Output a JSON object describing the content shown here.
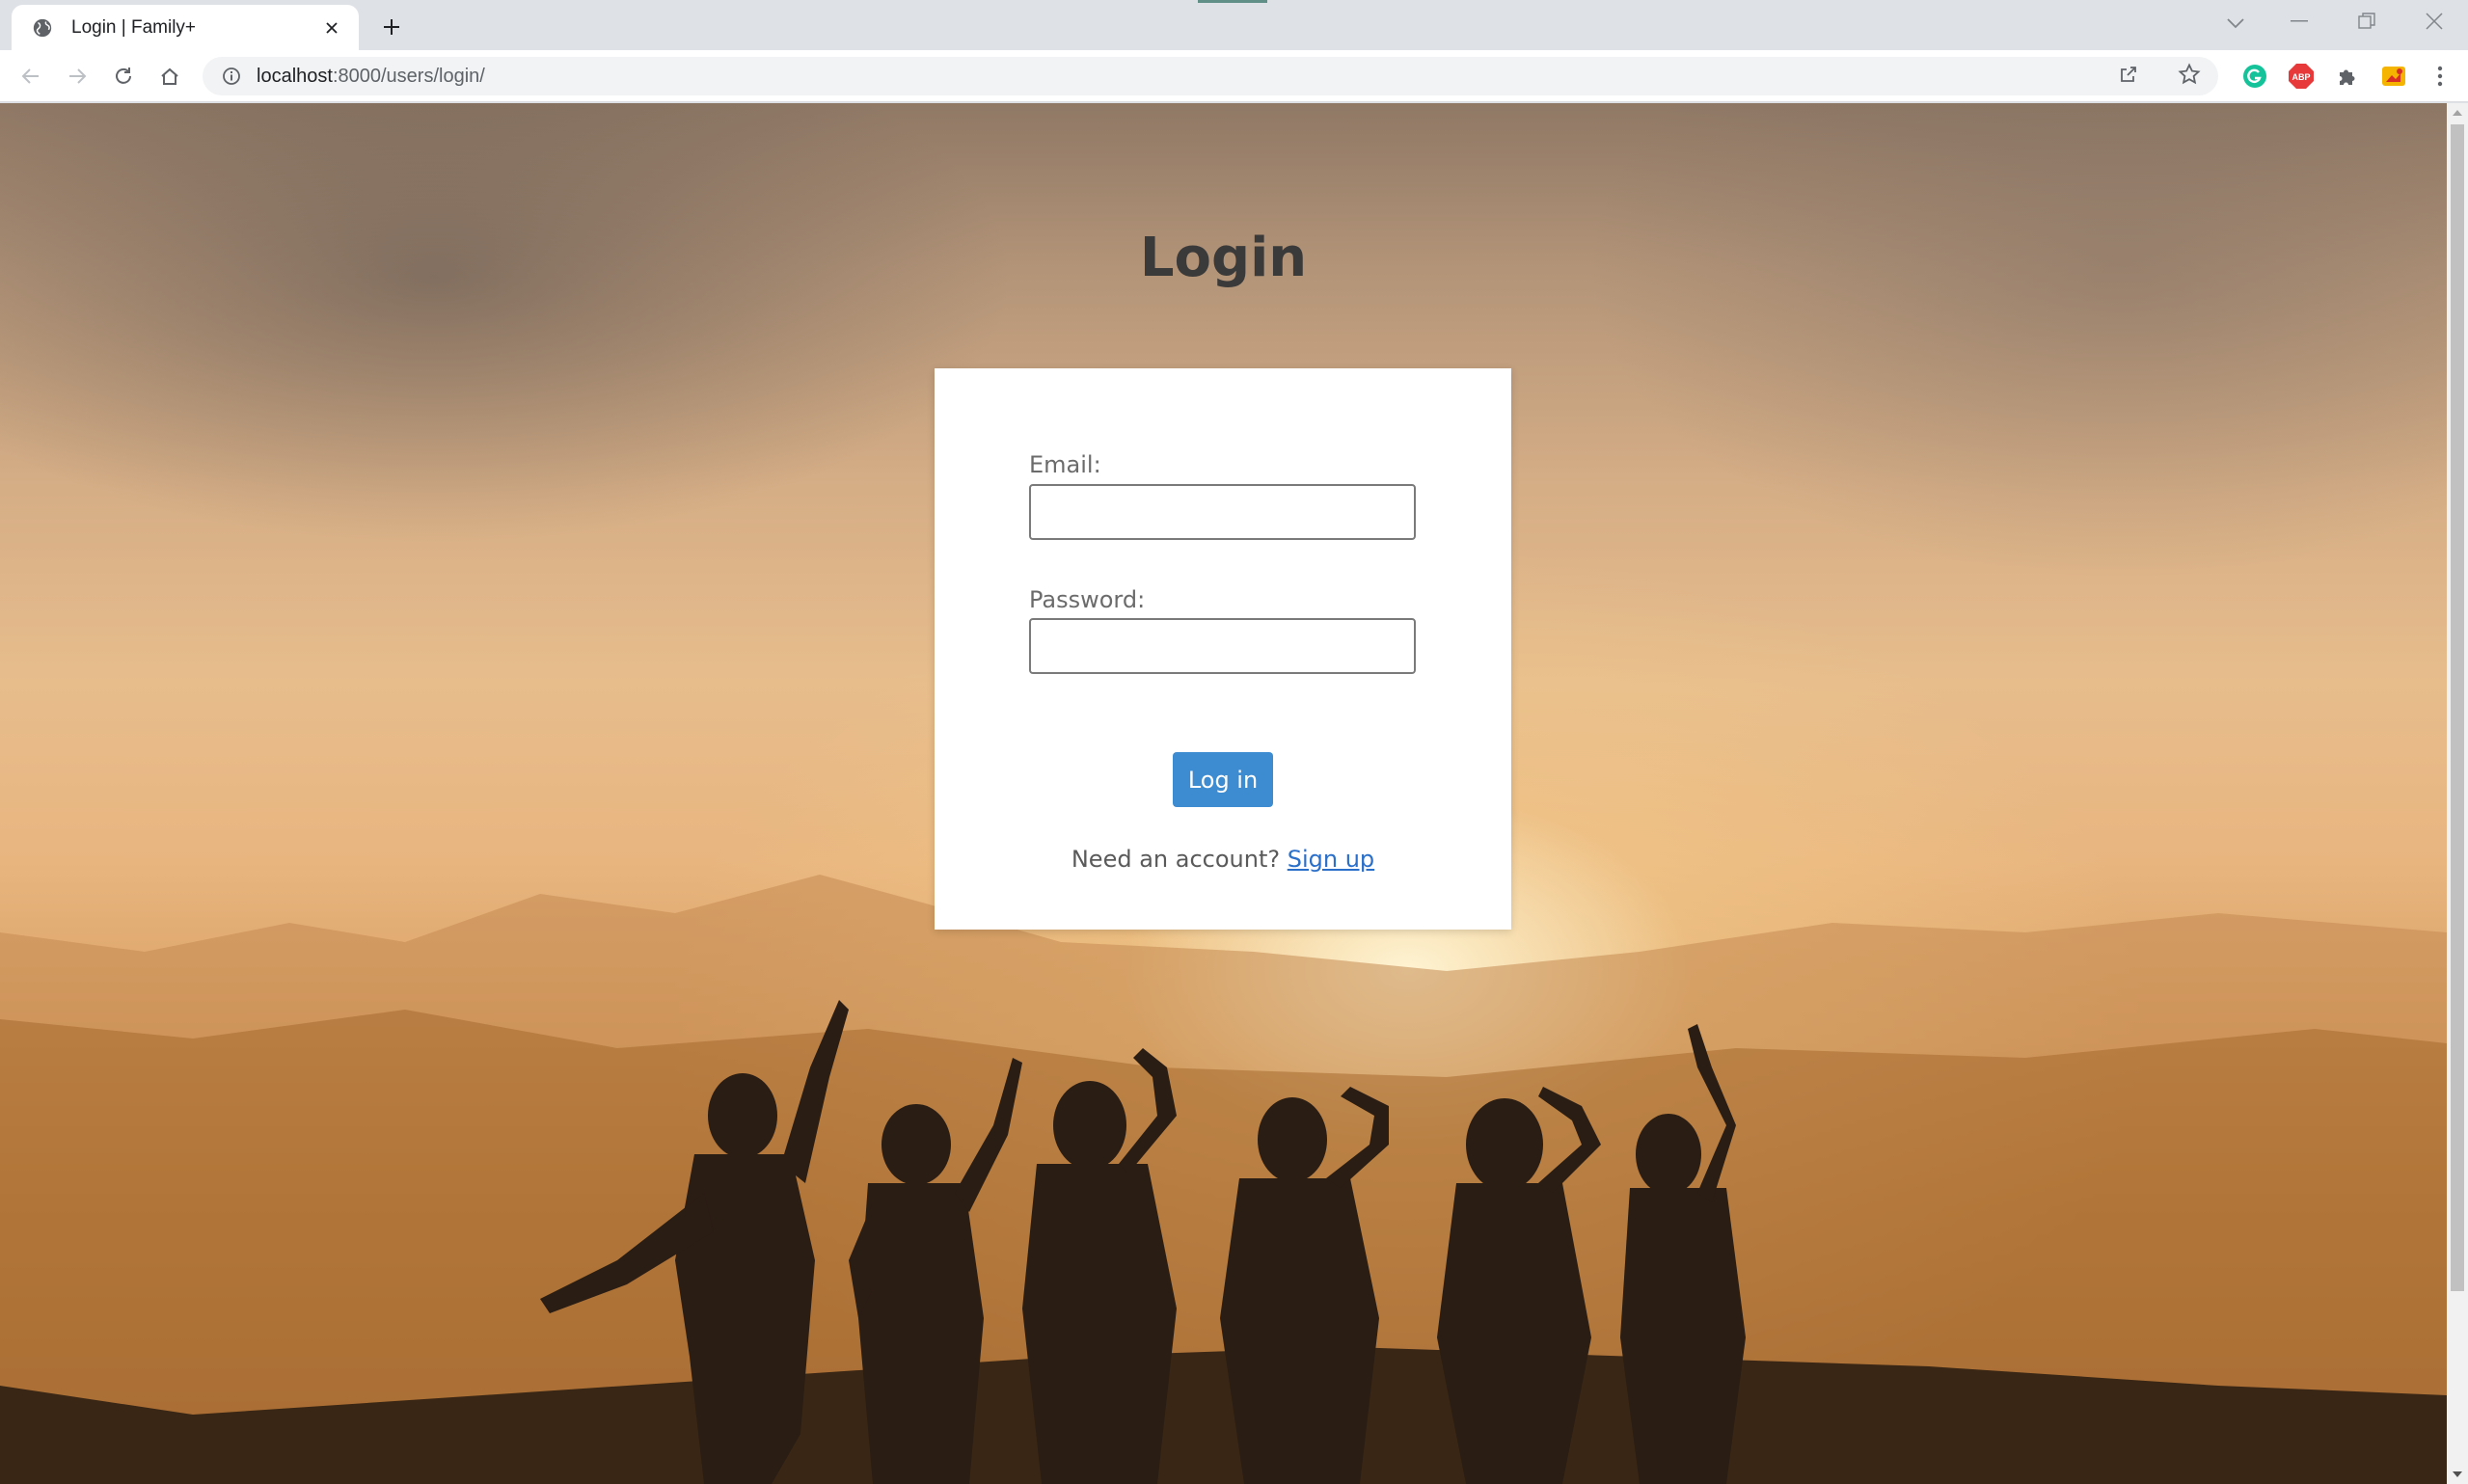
{
  "browser": {
    "tab": {
      "title": "Login | Family+"
    },
    "address_bar": {
      "host": "localhost",
      "path": ":8000/users/login/"
    },
    "icons": [
      "globe-icon",
      "close-icon",
      "plus-icon",
      "back-icon",
      "forward-icon",
      "reload-icon",
      "home-icon",
      "info-icon",
      "share-icon",
      "star-icon",
      "grammarly-icon",
      "adblock-icon",
      "puzzle-icon",
      "profile-extension-icon",
      "kebab-menu-icon",
      "tab-search-icon",
      "minimize-icon",
      "restore-icon",
      "window-close-icon"
    ],
    "extensions": {
      "adblock_label": "ABP"
    },
    "accent": "#5f8f86"
  },
  "page": {
    "title": "Login",
    "form": {
      "email_label": "Email:",
      "email_value": "",
      "password_label": "Password:",
      "password_value": "",
      "submit_label": "Log in",
      "signup_prompt": "Need an account?",
      "signup_link": "Sign up"
    },
    "colors": {
      "button": "#3d8bd0",
      "link": "#2a6fc9",
      "card": "#ffffff"
    }
  }
}
